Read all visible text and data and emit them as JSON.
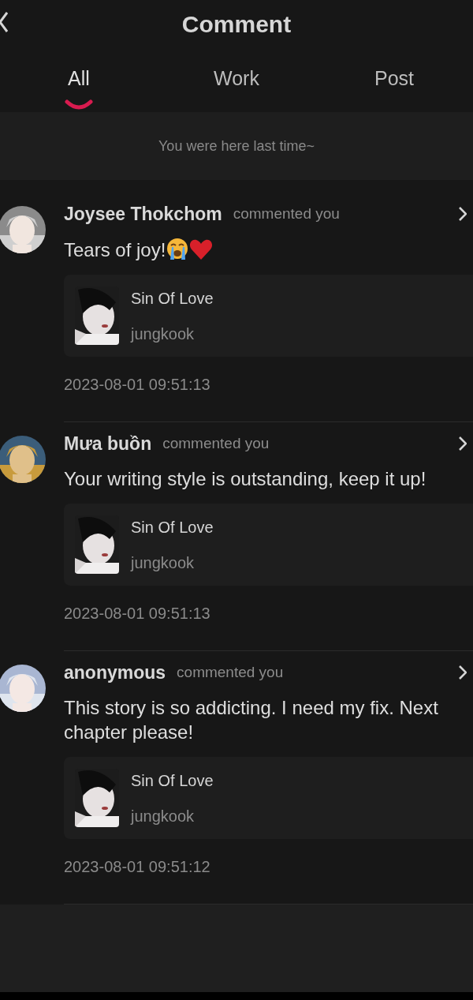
{
  "header": {
    "title": "Comment"
  },
  "tabs": [
    {
      "label": "All",
      "selected": true
    },
    {
      "label": "Work",
      "selected": false
    },
    {
      "label": "Post",
      "selected": false
    }
  ],
  "notice": "You were here last time~",
  "comments": [
    {
      "user": "Joysee Thokchom",
      "action": "commented you",
      "text": "Tears of joy!",
      "emojis": [
        {
          "kind": "crying-face"
        },
        {
          "kind": "heart"
        }
      ],
      "work": {
        "title": "Sin Of Love",
        "author": "jungkook"
      },
      "time": "2023-08-01 09:51:13"
    },
    {
      "user": "Mưa buồn",
      "action": "commented you",
      "text": "Your writing style is outstanding, keep it up!",
      "work": {
        "title": "Sin Of Love",
        "author": "jungkook"
      },
      "time": "2023-08-01 09:51:13"
    },
    {
      "user": "anonymous",
      "action": "commented you",
      "text": "This story is so addicting. I need my fix. Next chapter please!",
      "work": {
        "title": "Sin Of Love",
        "author": "jungkook"
      },
      "time": "2023-08-01 09:51:12"
    }
  ]
}
